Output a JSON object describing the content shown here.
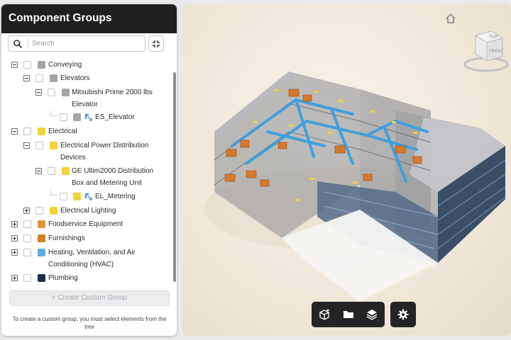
{
  "panel": {
    "title": "Component Groups",
    "search_placeholder": "Search",
    "create_button": "+ Create Custom Group",
    "hint": "To create a custom group, you must select elements from the tree"
  },
  "tree": [
    {
      "id": "conveying",
      "label": "Conveying",
      "expanded": true,
      "color": "#a5a5a9"
    },
    {
      "id": "elevators",
      "label": "Elevators",
      "expanded": true,
      "color": "#a5a5a9"
    },
    {
      "id": "mitsubishi",
      "label": "Mitsubishi Prime 2000 lbs",
      "label2": "Elevator",
      "expanded": true,
      "color": "#a5a5a9"
    },
    {
      "id": "es-elevator",
      "label": "ES_Elevator",
      "color": "#a5a5a9"
    },
    {
      "id": "electrical",
      "label": "Electrical",
      "expanded": true,
      "color": "#f2d23c"
    },
    {
      "id": "epd",
      "label": "Electrical Power Distribution",
      "label2": "Devices",
      "expanded": true,
      "color": "#f2d23c"
    },
    {
      "id": "ge",
      "label": "GE Ultim2000 Distribution",
      "label2": "Box and Metering Unit",
      "expanded": true,
      "color": "#f2d23c"
    },
    {
      "id": "el-metering",
      "label": "EL_Metering",
      "color": "#f2d23c"
    },
    {
      "id": "lighting",
      "label": "Electrical Lighting",
      "expanded": false,
      "color": "#f2d23c"
    },
    {
      "id": "foodservice",
      "label": "Foodservice Equipment",
      "expanded": false,
      "color": "#e8a23c"
    },
    {
      "id": "furnishings",
      "label": "Furnishings",
      "expanded": false,
      "color": "#e08a2c"
    },
    {
      "id": "hvac",
      "label": "Heating, Ventilation, and Air",
      "label2": "Conditioning (HVAC)",
      "expanded": false,
      "color": "#4aa3df"
    },
    {
      "id": "plumbing",
      "label": "Plumbing",
      "expanded": false,
      "color": "#17324d"
    }
  ],
  "viewer": {
    "viewcube_top": "TOP",
    "viewcube_front": "FRONT"
  },
  "toolbar": {
    "icons": [
      "model-browser-icon",
      "folder-icon",
      "layers-icon"
    ],
    "settings_icon": "gear-icon"
  }
}
